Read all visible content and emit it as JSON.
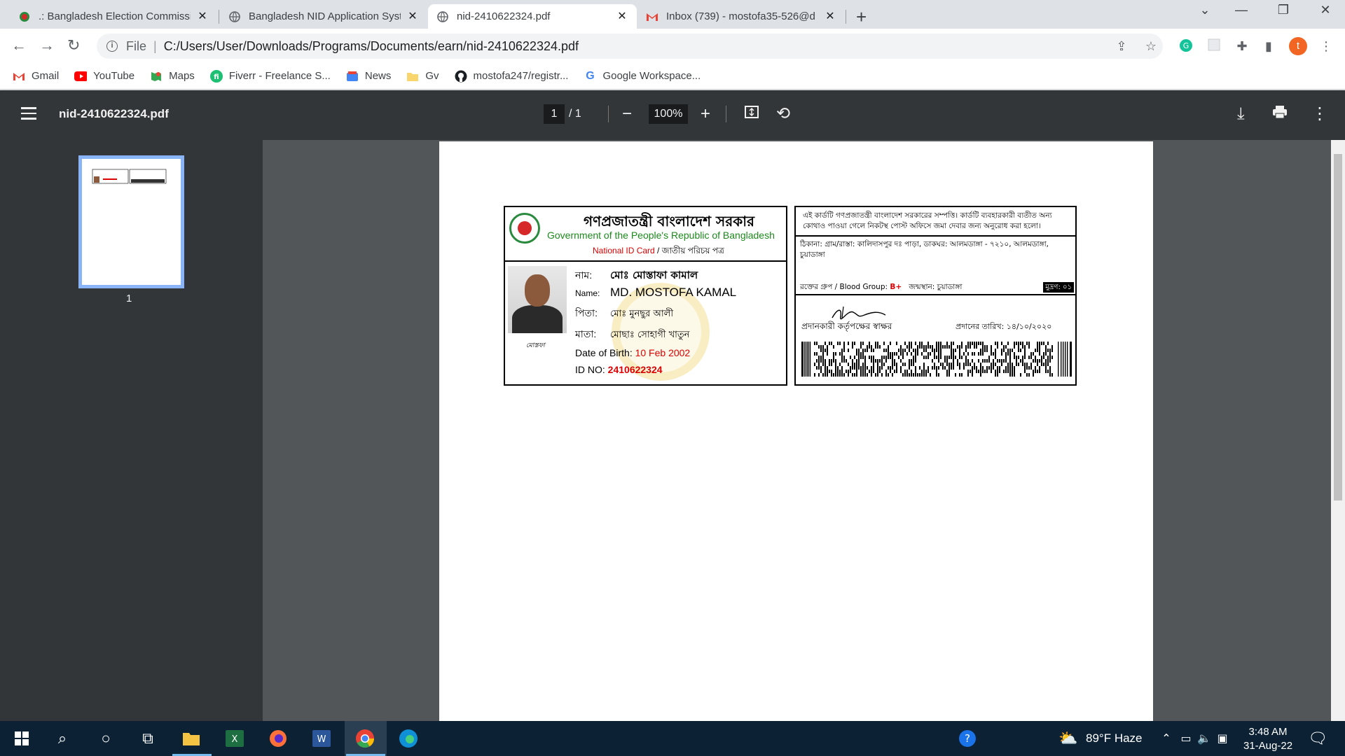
{
  "tabs": [
    {
      "title": ".: Bangladesh Election Commissio",
      "icon": "ec-logo-icon"
    },
    {
      "title": "Bangladesh NID Application Syst",
      "icon": "globe-icon"
    },
    {
      "title": "nid-2410622324.pdf",
      "icon": "globe-icon"
    },
    {
      "title": "Inbox (739) - mostofa35-526@d",
      "icon": "gmail-icon"
    }
  ],
  "address": {
    "scheme": "File",
    "url": "C:/Users/User/Downloads/Programs/Documents/earn/nid-2410622324.pdf"
  },
  "profile_initial": "t",
  "bookmarks": [
    {
      "label": "Gmail",
      "icon": "gmail-icon"
    },
    {
      "label": "YouTube",
      "icon": "youtube-icon"
    },
    {
      "label": "Maps",
      "icon": "maps-icon"
    },
    {
      "label": "Fiverr - Freelance S...",
      "icon": "fiverr-icon"
    },
    {
      "label": "News",
      "icon": "news-icon"
    },
    {
      "label": "Gv",
      "icon": "folder-icon"
    },
    {
      "label": "mostofa247/registr...",
      "icon": "github-icon"
    },
    {
      "label": "Google Workspace...",
      "icon": "google-icon"
    }
  ],
  "pdf": {
    "filename": "nid-2410622324.pdf",
    "page_current": "1",
    "page_total": "/  1",
    "zoom": "100%",
    "thumbnail_number": "1"
  },
  "card_front": {
    "bn_title": "গণপ্রজাতন্ত্রী বাংলাদেশ সরকার",
    "en_title": "Government of the People's Republic of Bangladesh",
    "sub_red": "National ID Card",
    "sub_rest": " / জাতীয় পরিচয় পত্র",
    "name_bn_label": "নাম:",
    "name_bn": "মোঃ মোস্তাফা কামাল",
    "name_en_label": "Name:",
    "name_en": "MD. MOSTOFA KAMAL",
    "father_label": "পিতা:",
    "father": "মোঃ মুনছুর আলী",
    "mother_label": "মাতা:",
    "mother": "মোছাঃ সোহাগী খাতুন",
    "dob_label": "Date of Birth: ",
    "dob": "10 Feb 2002",
    "id_label": "ID NO: ",
    "id": "2410622324",
    "photo_signature": "মোস্তফা"
  },
  "card_back": {
    "notice": "এই কার্ডটি গণপ্রজাতন্ত্রী বাংলাদেশ সরকারের সম্পত্তি। কার্ডটি ব্যবহারকারী ব্যতীত অন্য কোথাও পাওয়া গেলে নিকটস্থ পোস্ট অফিসে জমা দেবার জন্য অনুরোধ করা হলো।",
    "address": "ঠিকানা: গ্রাম/রাস্তা: কালিদাসপুর দঃ পাড়া, ডাকঘর: আলমডাঙ্গা - ৭২১০, আলমডাঙ্গা, চুয়াডাঙ্গা",
    "blood_label": "রক্তের গ্রুপ / Blood Group: ",
    "blood": "B+",
    "birthplace": "জন্মস্থান: চুয়াডাঙ্গা",
    "mudron": "মুদ্রণ: ০১",
    "signer": "প্রদানকারী কর্তৃপক্ষের স্বাক্ষর",
    "issue_date": "প্রদানের তারিখ:  ১৪/১০/২০২০"
  },
  "taskbar": {
    "weather": "89°F  Haze",
    "time": "3:48 AM",
    "date": "31-Aug-22"
  }
}
